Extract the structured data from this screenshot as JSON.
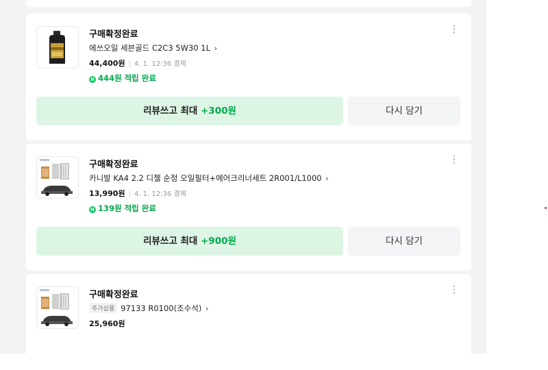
{
  "orders": [
    {
      "status": "구매확정완료",
      "title": "에쓰오일 세븐골드 C2C3 5W30 1L",
      "price": "44,400원",
      "date": "4. 1. 12:36 결제",
      "point": "444원 적립 완료",
      "review_label": "리뷰쓰고 최대 ",
      "review_bonus": "+300원",
      "cart_label": "다시 담기"
    },
    {
      "status": "구매확정완료",
      "title": "카니발 KA4 2.2 디젤 순정 오일필터+에어크리너세트 2R001/L1000",
      "price": "13,990원",
      "date": "4. 1. 12:36 결제",
      "point": "139원 적립 완료",
      "review_label": "리뷰쓰고 최대 ",
      "review_bonus": "+900원",
      "cart_label": "다시 담기"
    },
    {
      "status": "구매확정완료",
      "tag": "추가상품",
      "title": "97133 R0100(조수석)",
      "price": "25,960원"
    }
  ],
  "icons": {
    "chevron": "›",
    "more": "⋮",
    "naver_point": "N"
  },
  "colors": {
    "accent_green": "#03a94d",
    "review_button_bg": "#dcf5e5",
    "page_bg": "#f2f3f5"
  }
}
